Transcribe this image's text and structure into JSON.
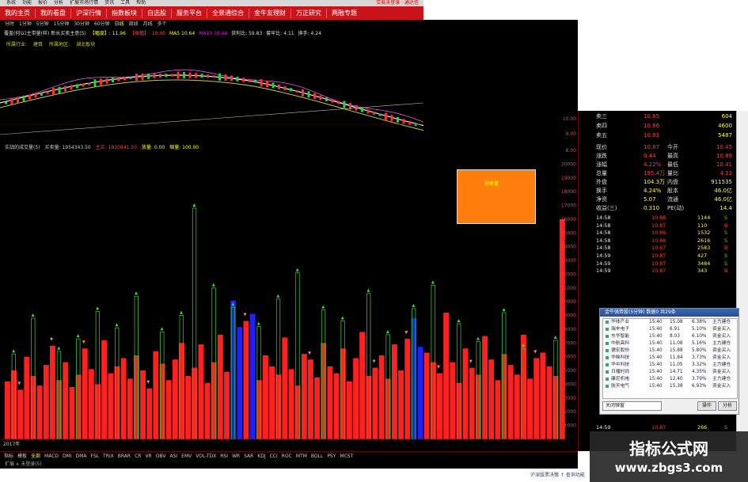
{
  "menu": {
    "items": [
      "系统",
      "功能",
      "报价",
      "分析",
      "扩展市场行情",
      "资讯",
      "工具",
      "帮助"
    ],
    "right_text": "交易未登录 · 通达信"
  },
  "nav": {
    "tabs": [
      "我的主页",
      "我的看盘",
      "沪深行情",
      "指数板块",
      "自选股",
      "服务平台",
      "全景通综合",
      "金牛友理财",
      "万正研究",
      "两融专题"
    ]
  },
  "chart": {
    "periods": [
      "分时",
      "1分钟",
      "5分钟",
      "15分钟",
      "30分钟",
      "60分钟",
      "日线",
      "周线",
      "月线",
      "多个"
    ],
    "info_line": [
      "覆盖(何以)主带量(样) 新长买卖主意(5)",
      "【幅度】: 11.96",
      "【振幅】: 10.00",
      "MA5 10.64",
      "MA10 10.44",
      "获利比: 59.83",
      "套牢比: 4.11",
      "换手: 4.24"
    ],
    "sub_info": [
      "所属行业:",
      "建筑",
      "所属地区:",
      "湖北板块"
    ],
    "vol_header": [
      "实战的成交量(5)",
      "买卖量: 1954343.50",
      "主买: 1810841.50",
      "放量: 0.00",
      "缩量: 100.00"
    ],
    "orange_box_label": "抢筹量",
    "price_axis": [
      "8.00",
      "9.00",
      "10.00"
    ],
    "vol_axis": [
      "20000",
      "19000",
      "18000",
      "17000",
      "16000",
      "15000",
      "14000",
      "13000",
      "12000",
      "11000",
      "10000",
      "9000",
      "8000",
      "7000",
      "6000",
      "5000",
      "4000",
      "3000",
      "2000",
      "1000"
    ],
    "year_label": "2017年"
  },
  "quote": {
    "asks": [
      {
        "label": "卖三",
        "price": "10.85",
        "vol": "604"
      },
      {
        "label": "卖四",
        "price": "10.86",
        "vol": "4600"
      },
      {
        "label": "卖五",
        "price": "10.83",
        "vol": "5487"
      }
    ],
    "stats": [
      {
        "l1": "现价",
        "v1": "10.87",
        "l2": "今开",
        "v2": "10.45"
      },
      {
        "l1": "涨跌",
        "v1": "0.44",
        "l2": "最高",
        "v2": "10.89"
      },
      {
        "l1": "涨幅",
        "v1": "4.22%",
        "l2": "最低",
        "v2": "10.41"
      },
      {
        "l1": "总量",
        "v1": "195.4万",
        "l2": "量比",
        "v2": "4.13"
      },
      {
        "l1": "外盘",
        "v1": "104.3万",
        "l2": "内盘",
        "v2": "911535"
      },
      {
        "l1": "换手",
        "v1": "4.24%",
        "l2": "股本",
        "v2": "46.0亿"
      },
      {
        "l1": "净资",
        "v1": "5.07",
        "l2": "流通",
        "v2": "46.0亿"
      },
      {
        "l1": "收益(三)",
        "v1": "0.310",
        "l2": "PE(动)",
        "v2": "14.4"
      }
    ],
    "ticks": [
      {
        "t": "14:58",
        "p": "10.86",
        "v": "1144",
        "f": "S"
      },
      {
        "t": "14:58",
        "p": "10.87",
        "v": "110",
        "f": "B"
      },
      {
        "t": "14:58",
        "p": "10.86",
        "v": "1532",
        "f": "S"
      },
      {
        "t": "14:58",
        "p": "10.86",
        "v": "2616",
        "f": "S"
      },
      {
        "t": "14:58",
        "p": "10.87",
        "v": "2583",
        "f": "B"
      },
      {
        "t": "14:59",
        "p": "10.87",
        "v": "427",
        "f": "S"
      },
      {
        "t": "14:59",
        "p": "10.87",
        "v": "3484",
        "f": "S"
      },
      {
        "t": "14:59",
        "p": "10.87",
        "v": "343",
        "f": "B"
      }
    ],
    "bottom_tick": {
      "t": "14:59",
      "p": "10.87",
      "v": "266",
      "f": "S"
    }
  },
  "popup": {
    "title": "金牛强势股(5分钟) 数据0 共29条",
    "rows": [
      {
        "name": "华体产业",
        "time": "15:40",
        "price": "15.08",
        "pct": "6.38%",
        "tag": "主力建仓"
      },
      {
        "name": "瑞丰电子",
        "time": "15:40",
        "price": "6.91",
        "pct": "5.10%",
        "tag": "资金买入"
      },
      {
        "name": "东华智能",
        "time": "15:40",
        "price": "8.03",
        "pct": "6.10%",
        "tag": "资金买入"
      },
      {
        "name": "中航高科",
        "time": "15:40",
        "price": "11.08",
        "pct": "5.16%",
        "tag": "主力建仓"
      },
      {
        "name": "德宏股份",
        "time": "15:40",
        "price": "15.88",
        "pct": "5.80%",
        "tag": "资金买入"
      },
      {
        "name": "华映科技",
        "time": "15:40",
        "price": "11.84",
        "pct": "3.73%",
        "tag": "资金买入"
      },
      {
        "name": "华中科技",
        "time": "15:40",
        "price": "11.05",
        "pct": "3.32%",
        "tag": "主力建仓"
      },
      {
        "name": "日播时尚",
        "time": "15:40",
        "price": "14.71",
        "pct": "4.35%",
        "tag": "资金买入"
      },
      {
        "name": "康尼机电",
        "time": "15:40",
        "price": "12.40",
        "pct": "3.79%",
        "tag": "主力建仓"
      },
      {
        "name": "航天电气",
        "time": "15:40",
        "price": "15.38",
        "pct": "6.93%",
        "tag": "资金买入"
      }
    ],
    "close_label": "关闭弹窗",
    "btn1": "操作",
    "btn2": "分析"
  },
  "bottom_tabs": [
    "指标",
    "模板",
    "全部",
    "MACD",
    "DMI",
    "DMA",
    "FSL",
    "TRIX",
    "BRAR",
    "CR",
    "VR",
    "OBV",
    "ASI",
    "EMV",
    "VOL-TDX",
    "RSI",
    "WR",
    "SAR",
    "KDJ",
    "CCI",
    "ROC",
    "MTM",
    "BOLL",
    "PSY",
    "MCST"
  ],
  "status_text": "扩展 ∧ 未登录(5)",
  "status_bottom": "沪深股票决策 ↑ 查询功能",
  "watermark": {
    "line1": "指标公式网",
    "line2": "www.zbgs3.com"
  },
  "colors": {
    "up": "#ff2020",
    "down": "#20c020",
    "accent": "#c8141a",
    "blue": "#2020ff",
    "orange": "#ff7f0e"
  },
  "chart_data": {
    "type": "bar",
    "title": "",
    "ylim": [
      0,
      21000
    ],
    "series": [
      {
        "name": "red",
        "values": [
          4200,
          5000,
          3600,
          6000,
          4600,
          3900,
          5400,
          6800,
          4300,
          5600,
          3800,
          4700,
          6600,
          5100,
          4000,
          7200,
          4800,
          5300,
          5900,
          4400,
          6100,
          5000,
          3700,
          6400,
          5500,
          4300,
          5800,
          7000,
          4600,
          5200,
          6900,
          4100,
          5600,
          7600,
          4900,
          6300,
          5100,
          8600,
          5700,
          4300,
          6100,
          5300,
          4700,
          7400,
          5100,
          3900,
          6200,
          5800,
          4500,
          7000,
          5300,
          4800,
          6600,
          4200,
          5900,
          7800,
          4600,
          5200,
          6100,
          4400,
          6900,
          5000,
          7300,
          5500,
          4200,
          6300,
          5600,
          4800,
          9200,
          5600,
          4100,
          6600,
          5200,
          4700,
          7500,
          5800,
          4300,
          6200,
          5400,
          4700,
          7600,
          4400,
          5900,
          6300,
          5300,
          4600,
          16000
        ]
      },
      {
        "name": "green",
        "values": [
          0,
          6200,
          0,
          0,
          8800,
          0,
          0,
          0,
          6400,
          0,
          0,
          7300,
          0,
          0,
          9300,
          0,
          0,
          8100,
          0,
          0,
          10400,
          0,
          0,
          0,
          7800,
          0,
          0,
          9000,
          0,
          16800,
          0,
          0,
          11000,
          0,
          0,
          9600,
          0,
          0,
          0,
          8200,
          0,
          0,
          10200,
          0,
          0,
          12100,
          0,
          0,
          0,
          9400,
          0,
          0,
          8600,
          0,
          0,
          0,
          10600,
          0,
          0,
          7600,
          0,
          0,
          0,
          9500,
          0,
          0,
          11200,
          0,
          0,
          0,
          8400,
          0,
          0,
          7100,
          0,
          0,
          0,
          9200,
          0,
          0,
          6600,
          0,
          0,
          0,
          0,
          7200,
          0
        ]
      },
      {
        "name": "blue",
        "values": [
          0,
          0,
          0,
          0,
          0,
          0,
          0,
          0,
          0,
          0,
          0,
          0,
          0,
          0,
          0,
          0,
          0,
          0,
          0,
          0,
          0,
          0,
          0,
          0,
          0,
          0,
          0,
          0,
          0,
          0,
          0,
          0,
          0,
          0,
          0,
          0,
          0,
          0,
          0,
          0,
          0,
          0,
          0,
          0,
          0,
          0,
          0,
          0,
          0,
          0,
          0,
          0,
          0,
          0,
          0,
          0,
          0,
          0,
          0,
          0,
          0,
          0,
          0,
          0,
          0,
          0,
          0,
          0,
          0,
          0,
          0,
          0,
          0,
          0,
          0,
          0,
          0,
          0,
          0,
          0,
          0,
          0,
          0,
          0,
          0,
          0,
          0
        ]
      }
    ]
  }
}
